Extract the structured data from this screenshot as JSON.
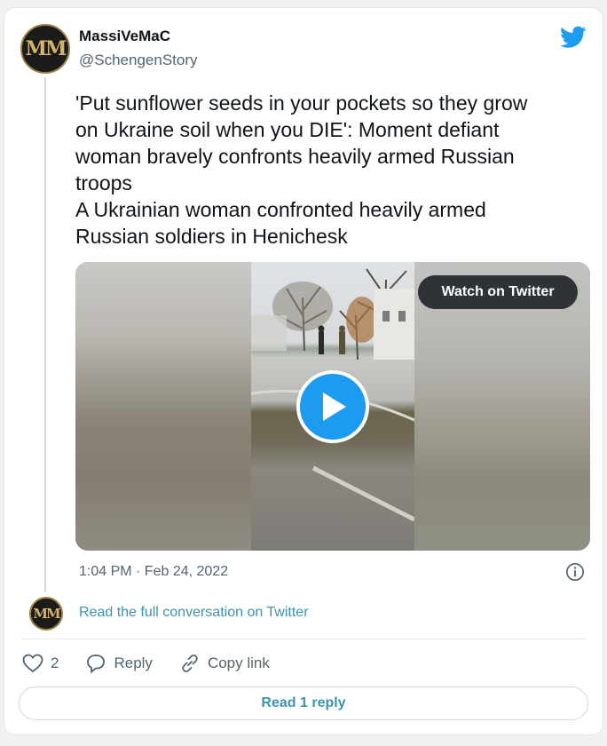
{
  "tweet": {
    "author_name": "MassiVeMaC",
    "author_handle": "@SchengenStory",
    "avatar_monogram": "MM",
    "text_lines": [
      "'Put sunflower seeds in your pockets so they grow",
      "on Ukraine soil when you DIE': Moment defiant",
      "woman bravely confronts heavily armed Russian",
      "troops",
      "A Ukrainian woman confronted heavily armed",
      "Russian soldiers in Henichesk"
    ],
    "media": {
      "watch_label": "Watch on Twitter",
      "play_icon": "play-icon"
    },
    "timestamp": "1:04 PM · Feb 24, 2022",
    "read_conversation": "Read the full conversation on Twitter",
    "actions": {
      "likes_count": "2",
      "reply_label": "Reply",
      "copy_link_label": "Copy link"
    },
    "read_replies": "Read 1 reply"
  },
  "colors": {
    "brand_blue": "#1d9bf0",
    "link_teal": "#3c93ac",
    "text_primary": "#0f1419",
    "text_secondary": "#536471"
  }
}
